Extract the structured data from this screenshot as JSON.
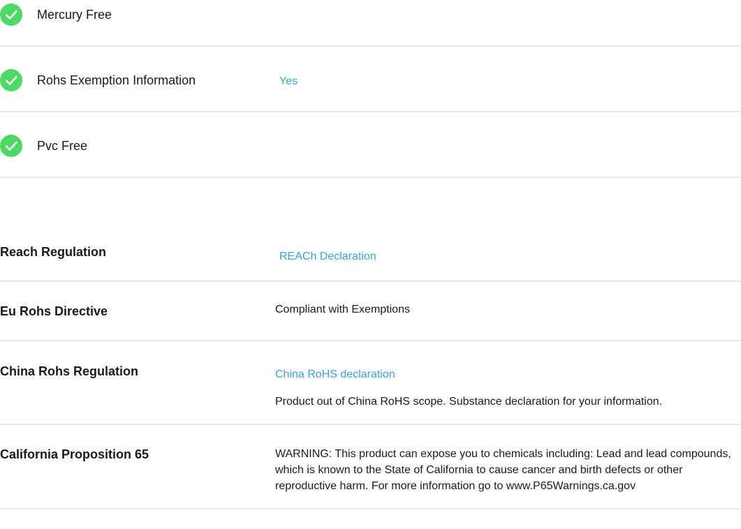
{
  "features": [
    {
      "icon": "check-circle-icon",
      "label": "Mercury Free",
      "value": ""
    },
    {
      "icon": "check-circle-icon",
      "label": "Rohs Exemption Information",
      "value": "Yes"
    },
    {
      "icon": "check-circle-icon",
      "label": "Pvc Free",
      "value": ""
    }
  ],
  "regulations": {
    "reach": {
      "label": "Reach Regulation",
      "link": "REACh Declaration"
    },
    "eu_rohs": {
      "label": "Eu Rohs Directive",
      "text": "Compliant with Exemptions"
    },
    "china_rohs": {
      "label": "China Rohs Regulation",
      "link": "China RoHS declaration",
      "text": "Product out of China RoHS scope. Substance declaration for your information."
    },
    "california": {
      "label": "California Proposition 65",
      "text": "WARNING: This product can expose you to chemicals including: Lead and lead compounds, which is known to the State of California to cause cancer and birth defects or other reproductive harm. For more information go to www.P65Warnings.ca.gov"
    }
  },
  "colors": {
    "check_green": "#4cd964",
    "link_blue": "#3aa3d3",
    "divider": "#e9e9e9"
  }
}
